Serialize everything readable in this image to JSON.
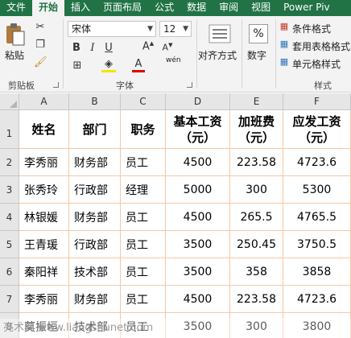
{
  "tabs": [
    "文件",
    "开始",
    "插入",
    "页面布局",
    "公式",
    "数据",
    "审阅",
    "视图",
    "Power Piv"
  ],
  "ribbon": {
    "clipboard": {
      "paste": "粘贴",
      "group": "剪贴板"
    },
    "font": {
      "name": "宋体",
      "size": "12",
      "wen": "wén",
      "group": "字体"
    },
    "alignment": {
      "label": "对齐方式"
    },
    "number": {
      "symbol": "%",
      "label": "数字"
    },
    "styles": {
      "items": [
        "条件格式",
        "套用表格格式",
        "单元格样式"
      ],
      "group": "样式"
    }
  },
  "sheet": {
    "columns": [
      "A",
      "B",
      "C",
      "D",
      "E",
      "F"
    ],
    "rows": [
      "1",
      "2",
      "3",
      "4",
      "5",
      "6",
      "7",
      "8"
    ],
    "headers": [
      "姓名",
      "部门",
      "职务",
      "基本工资\n（元）",
      "加班费\n（元）",
      "应发工资\n（元）"
    ],
    "data": [
      [
        "李秀丽",
        "财务部",
        "员工",
        "4500",
        "223.58",
        "4723.6"
      ],
      [
        "张秀玲",
        "行政部",
        "经理",
        "5000",
        "300",
        "5300"
      ],
      [
        "林银媛",
        "财务部",
        "员工",
        "4500",
        "265.5",
        "4765.5"
      ],
      [
        "王青瑗",
        "行政部",
        "员工",
        "3500",
        "250.45",
        "3750.5"
      ],
      [
        "秦阳祥",
        "技术部",
        "员工",
        "3500",
        "358",
        "3858"
      ],
      [
        "李秀丽",
        "财务部",
        "员工",
        "4500",
        "223.58",
        "4723.6"
      ],
      [
        "莫振垣",
        "技术部",
        "员工",
        "3500",
        "300",
        "3800"
      ]
    ]
  },
  "watermark": "亮术网 www.liangshunet.com",
  "colors": {
    "excel_green": "#217346",
    "grid": "#f4c9a8"
  }
}
